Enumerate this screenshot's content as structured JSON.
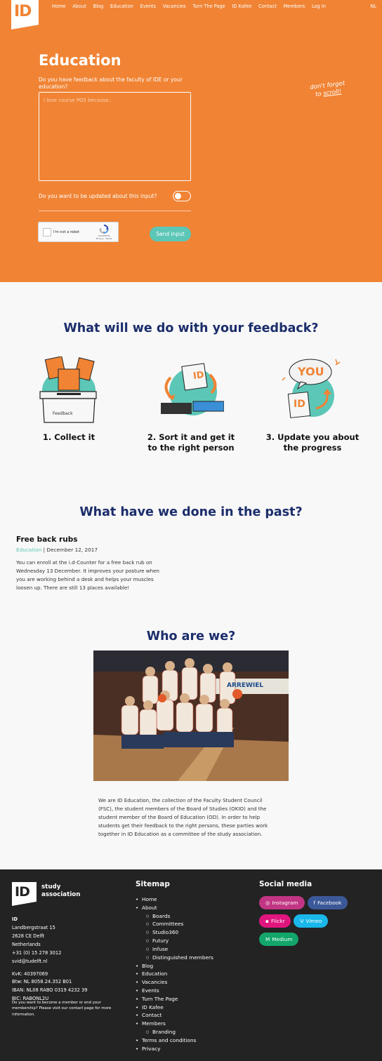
{
  "nav": {
    "logo": "ID",
    "items": [
      "Home",
      "About",
      "Blog",
      "Education",
      "Events",
      "Vacancies",
      "Turn The Page",
      "ID Kafee",
      "Contact",
      "Members",
      "Log In"
    ],
    "lang": "NL"
  },
  "hero": {
    "title": "Education",
    "question": "Do you have feedback about the faculty of IDE or your education?",
    "placeholder": "I love course PO5 because...",
    "update_question": "Do you want to be updated about this input?",
    "captcha_label": "I'm not a robot",
    "captcha_brand": "reCAPTCHA",
    "captcha_links": "Privacy - Terms",
    "send_label": "Send input",
    "scroll_hint_1": "don't forget",
    "scroll_hint_2": "to",
    "scroll_hint_3": "scroll!"
  },
  "process": {
    "title": "What will we do with your feedback?",
    "steps": [
      "1. Collect it",
      "2. Sort it and get it to the right person",
      "3. Update you about the progress"
    ],
    "box_label": "Feedback",
    "bubble_text": "YOU",
    "card_text": "ID"
  },
  "past": {
    "title": "What have we done in the past?",
    "post_title": "Free back rubs",
    "post_category": "Education",
    "post_date": " | December 12, 2017",
    "post_body": "You can enroll at the i.d-Counter for a free back rub on Wednesday 13 December. It improves your posture when you are working behind a desk and helps your muscles loosen up. There are still 13 places available!"
  },
  "who": {
    "title": "Who are we?",
    "photo_sign": "ARREWIEL",
    "body": "We are ID Education, the collection of the Faculty Student Council (FSC), the student members of the Board of Studies (OKIO) and the student member of the Board of Education (OD). In order to help students get their feedback to the right persons, these parties work together in ID Education as a committee of the study association."
  },
  "footer": {
    "logo": "ID",
    "brand_1": "study",
    "brand_2": "association",
    "org": "ID",
    "address": [
      "Landbergstraat 15",
      "2628 CE Delft",
      "Netherlands",
      "+31 (0) 15 278 3012",
      "svid@tudelft.nl"
    ],
    "legal": [
      "KvK: 40397069",
      "Btw: NL 8058.24.352 B01",
      "IBAN: NL08 RABO 0319 4232 39",
      "BIC: RABONL2U"
    ],
    "note": "Do you want to become a member or end your membership? Please visit our contact page for more information.",
    "sitemap_title": "Sitemap",
    "sitemap": [
      {
        "label": "Home",
        "level": 0
      },
      {
        "label": "About",
        "level": 0
      },
      {
        "label": "Boards",
        "level": 1
      },
      {
        "label": "Committees",
        "level": 1
      },
      {
        "label": "Studio360",
        "level": 1
      },
      {
        "label": "Futury",
        "level": 1
      },
      {
        "label": "Infuse",
        "level": 1
      },
      {
        "label": "Distinguished members",
        "level": 1
      },
      {
        "label": "Blog",
        "level": 0
      },
      {
        "label": "Education",
        "level": 0
      },
      {
        "label": "Vacancies",
        "level": 0
      },
      {
        "label": "Events",
        "level": 0
      },
      {
        "label": "Turn The Page",
        "level": 0
      },
      {
        "label": "ID Kafee",
        "level": 0
      },
      {
        "label": "Contact",
        "level": 0
      },
      {
        "label": "Members",
        "level": 0
      },
      {
        "label": "Branding",
        "level": 1
      },
      {
        "label": "Terms and conditions",
        "level": 0
      },
      {
        "label": "Privacy",
        "level": 0
      }
    ],
    "social_title": "Social media",
    "social": [
      {
        "label": "Instagram",
        "icon": "instagram-icon",
        "glyph": "◎",
        "color": "#c13584"
      },
      {
        "label": "Facebook",
        "icon": "facebook-icon",
        "glyph": "f",
        "color": "#3b5998"
      },
      {
        "label": "Flickr",
        "icon": "flickr-icon",
        "glyph": "▪",
        "color": "#e0167e"
      },
      {
        "label": "Vimeo",
        "icon": "vimeo-icon",
        "glyph": "V",
        "color": "#1ab7ea"
      },
      {
        "label": "Medium",
        "icon": "medium-icon",
        "glyph": "M",
        "color": "#12a66b"
      }
    ]
  },
  "colors": {
    "brand_orange": "#f08434",
    "accent_teal": "#5cc6b7",
    "heading_navy": "#1b2d6b",
    "footer_bg": "#232323"
  }
}
